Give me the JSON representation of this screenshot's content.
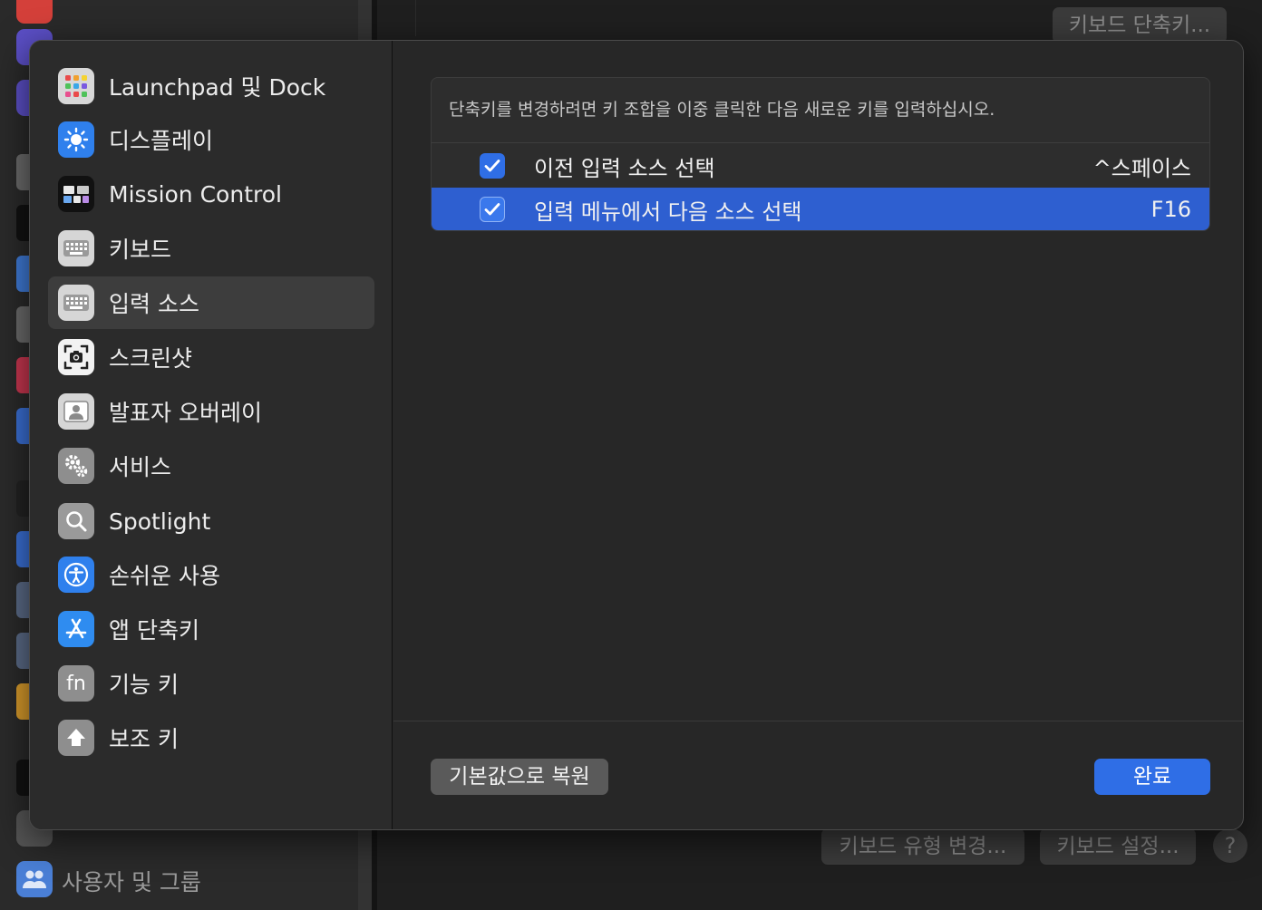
{
  "background": {
    "top_button": "키보드 단축키...",
    "bottom_buttons": [
      "키보드 유형 변경...",
      "키보드 설정..."
    ],
    "help": "?",
    "sidebar_last_item": "사용자 및 그룹"
  },
  "sidebar": {
    "items": [
      {
        "label": "Launchpad 및 Dock",
        "icon": "launchpad-icon"
      },
      {
        "label": "디스플레이",
        "icon": "display-icon"
      },
      {
        "label": "Mission Control",
        "icon": "mission-control-icon"
      },
      {
        "label": "키보드",
        "icon": "keyboard-icon"
      },
      {
        "label": "입력 소스",
        "icon": "input-sources-icon"
      },
      {
        "label": "스크린샷",
        "icon": "screenshot-icon"
      },
      {
        "label": "발표자 오버레이",
        "icon": "presenter-overlay-icon"
      },
      {
        "label": "서비스",
        "icon": "services-icon"
      },
      {
        "label": "Spotlight",
        "icon": "spotlight-icon"
      },
      {
        "label": "손쉬운 사용",
        "icon": "accessibility-icon"
      },
      {
        "label": "앱 단축키",
        "icon": "app-shortcuts-icon"
      },
      {
        "label": "기능 키",
        "icon": "function-keys-icon"
      },
      {
        "label": "보조 키",
        "icon": "modifier-keys-icon"
      }
    ],
    "selected_index": 4
  },
  "main": {
    "description": "단축키를 변경하려면 키 조합을 이중 클릭한 다음 새로운 키를 입력하십시오.",
    "shortcuts": [
      {
        "label": "이전 입력 소스 선택",
        "key": "^스페이스",
        "checked": true
      },
      {
        "label": "입력 메뉴에서 다음 소스 선택",
        "key": "F16",
        "checked": true
      }
    ],
    "fn_icon_text": "fn"
  },
  "footer": {
    "restore_label": "기본값으로 복원",
    "done_label": "완료"
  },
  "colors": {
    "accent": "#2f6ee6",
    "selection": "#2e5fd0",
    "sheet_bg": "#272727"
  }
}
